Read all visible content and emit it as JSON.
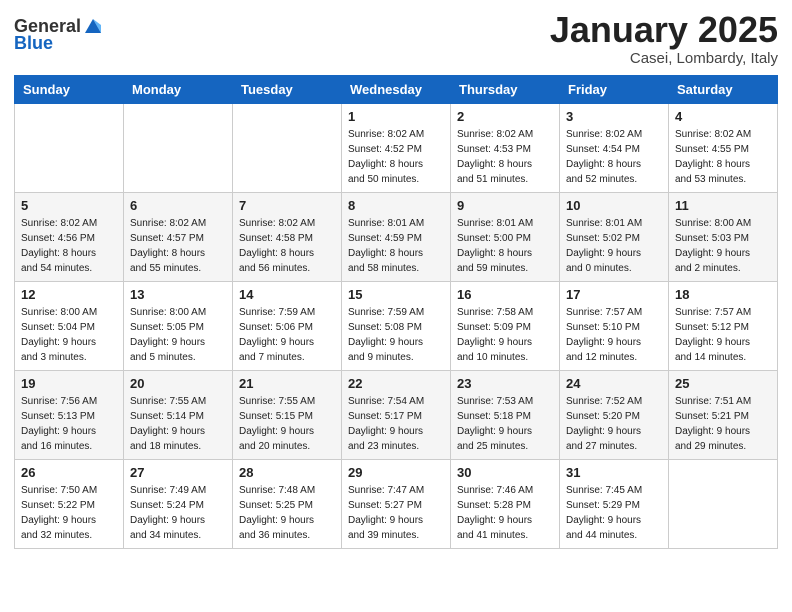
{
  "header": {
    "logo_line1": "General",
    "logo_line2": "Blue",
    "month": "January 2025",
    "location": "Casei, Lombardy, Italy"
  },
  "days_of_week": [
    "Sunday",
    "Monday",
    "Tuesday",
    "Wednesday",
    "Thursday",
    "Friday",
    "Saturday"
  ],
  "weeks": [
    [
      {
        "day": "",
        "info": ""
      },
      {
        "day": "",
        "info": ""
      },
      {
        "day": "",
        "info": ""
      },
      {
        "day": "1",
        "info": "Sunrise: 8:02 AM\nSunset: 4:52 PM\nDaylight: 8 hours\nand 50 minutes."
      },
      {
        "day": "2",
        "info": "Sunrise: 8:02 AM\nSunset: 4:53 PM\nDaylight: 8 hours\nand 51 minutes."
      },
      {
        "day": "3",
        "info": "Sunrise: 8:02 AM\nSunset: 4:54 PM\nDaylight: 8 hours\nand 52 minutes."
      },
      {
        "day": "4",
        "info": "Sunrise: 8:02 AM\nSunset: 4:55 PM\nDaylight: 8 hours\nand 53 minutes."
      }
    ],
    [
      {
        "day": "5",
        "info": "Sunrise: 8:02 AM\nSunset: 4:56 PM\nDaylight: 8 hours\nand 54 minutes."
      },
      {
        "day": "6",
        "info": "Sunrise: 8:02 AM\nSunset: 4:57 PM\nDaylight: 8 hours\nand 55 minutes."
      },
      {
        "day": "7",
        "info": "Sunrise: 8:02 AM\nSunset: 4:58 PM\nDaylight: 8 hours\nand 56 minutes."
      },
      {
        "day": "8",
        "info": "Sunrise: 8:01 AM\nSunset: 4:59 PM\nDaylight: 8 hours\nand 58 minutes."
      },
      {
        "day": "9",
        "info": "Sunrise: 8:01 AM\nSunset: 5:00 PM\nDaylight: 8 hours\nand 59 minutes."
      },
      {
        "day": "10",
        "info": "Sunrise: 8:01 AM\nSunset: 5:02 PM\nDaylight: 9 hours\nand 0 minutes."
      },
      {
        "day": "11",
        "info": "Sunrise: 8:00 AM\nSunset: 5:03 PM\nDaylight: 9 hours\nand 2 minutes."
      }
    ],
    [
      {
        "day": "12",
        "info": "Sunrise: 8:00 AM\nSunset: 5:04 PM\nDaylight: 9 hours\nand 3 minutes."
      },
      {
        "day": "13",
        "info": "Sunrise: 8:00 AM\nSunset: 5:05 PM\nDaylight: 9 hours\nand 5 minutes."
      },
      {
        "day": "14",
        "info": "Sunrise: 7:59 AM\nSunset: 5:06 PM\nDaylight: 9 hours\nand 7 minutes."
      },
      {
        "day": "15",
        "info": "Sunrise: 7:59 AM\nSunset: 5:08 PM\nDaylight: 9 hours\nand 9 minutes."
      },
      {
        "day": "16",
        "info": "Sunrise: 7:58 AM\nSunset: 5:09 PM\nDaylight: 9 hours\nand 10 minutes."
      },
      {
        "day": "17",
        "info": "Sunrise: 7:57 AM\nSunset: 5:10 PM\nDaylight: 9 hours\nand 12 minutes."
      },
      {
        "day": "18",
        "info": "Sunrise: 7:57 AM\nSunset: 5:12 PM\nDaylight: 9 hours\nand 14 minutes."
      }
    ],
    [
      {
        "day": "19",
        "info": "Sunrise: 7:56 AM\nSunset: 5:13 PM\nDaylight: 9 hours\nand 16 minutes."
      },
      {
        "day": "20",
        "info": "Sunrise: 7:55 AM\nSunset: 5:14 PM\nDaylight: 9 hours\nand 18 minutes."
      },
      {
        "day": "21",
        "info": "Sunrise: 7:55 AM\nSunset: 5:15 PM\nDaylight: 9 hours\nand 20 minutes."
      },
      {
        "day": "22",
        "info": "Sunrise: 7:54 AM\nSunset: 5:17 PM\nDaylight: 9 hours\nand 23 minutes."
      },
      {
        "day": "23",
        "info": "Sunrise: 7:53 AM\nSunset: 5:18 PM\nDaylight: 9 hours\nand 25 minutes."
      },
      {
        "day": "24",
        "info": "Sunrise: 7:52 AM\nSunset: 5:20 PM\nDaylight: 9 hours\nand 27 minutes."
      },
      {
        "day": "25",
        "info": "Sunrise: 7:51 AM\nSunset: 5:21 PM\nDaylight: 9 hours\nand 29 minutes."
      }
    ],
    [
      {
        "day": "26",
        "info": "Sunrise: 7:50 AM\nSunset: 5:22 PM\nDaylight: 9 hours\nand 32 minutes."
      },
      {
        "day": "27",
        "info": "Sunrise: 7:49 AM\nSunset: 5:24 PM\nDaylight: 9 hours\nand 34 minutes."
      },
      {
        "day": "28",
        "info": "Sunrise: 7:48 AM\nSunset: 5:25 PM\nDaylight: 9 hours\nand 36 minutes."
      },
      {
        "day": "29",
        "info": "Sunrise: 7:47 AM\nSunset: 5:27 PM\nDaylight: 9 hours\nand 39 minutes."
      },
      {
        "day": "30",
        "info": "Sunrise: 7:46 AM\nSunset: 5:28 PM\nDaylight: 9 hours\nand 41 minutes."
      },
      {
        "day": "31",
        "info": "Sunrise: 7:45 AM\nSunset: 5:29 PM\nDaylight: 9 hours\nand 44 minutes."
      },
      {
        "day": "",
        "info": ""
      }
    ]
  ]
}
